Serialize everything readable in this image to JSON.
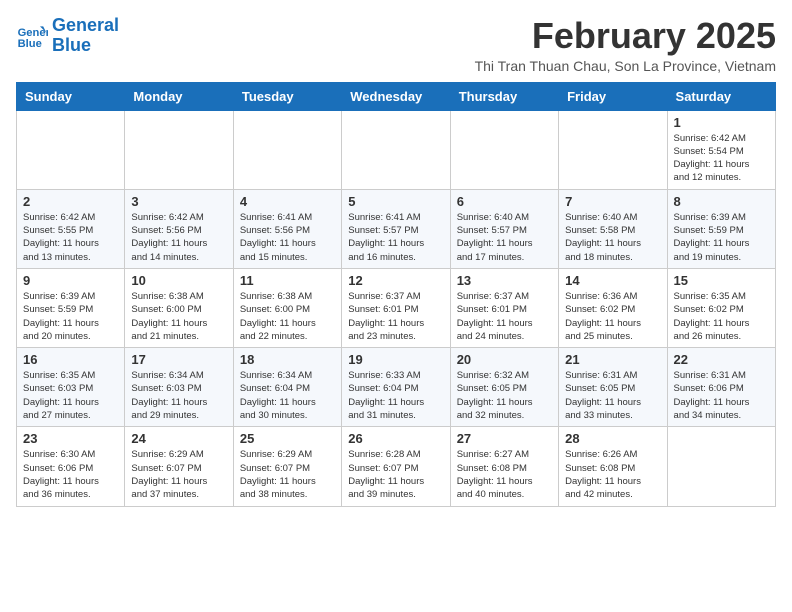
{
  "header": {
    "logo_line1": "General",
    "logo_line2": "Blue",
    "month_title": "February 2025",
    "location": "Thi Tran Thuan Chau, Son La Province, Vietnam"
  },
  "weekdays": [
    "Sunday",
    "Monday",
    "Tuesday",
    "Wednesday",
    "Thursday",
    "Friday",
    "Saturday"
  ],
  "weeks": [
    [
      {
        "day": "",
        "info": ""
      },
      {
        "day": "",
        "info": ""
      },
      {
        "day": "",
        "info": ""
      },
      {
        "day": "",
        "info": ""
      },
      {
        "day": "",
        "info": ""
      },
      {
        "day": "",
        "info": ""
      },
      {
        "day": "1",
        "info": "Sunrise: 6:42 AM\nSunset: 5:54 PM\nDaylight: 11 hours\nand 12 minutes."
      }
    ],
    [
      {
        "day": "2",
        "info": "Sunrise: 6:42 AM\nSunset: 5:55 PM\nDaylight: 11 hours\nand 13 minutes."
      },
      {
        "day": "3",
        "info": "Sunrise: 6:42 AM\nSunset: 5:56 PM\nDaylight: 11 hours\nand 14 minutes."
      },
      {
        "day": "4",
        "info": "Sunrise: 6:41 AM\nSunset: 5:56 PM\nDaylight: 11 hours\nand 15 minutes."
      },
      {
        "day": "5",
        "info": "Sunrise: 6:41 AM\nSunset: 5:57 PM\nDaylight: 11 hours\nand 16 minutes."
      },
      {
        "day": "6",
        "info": "Sunrise: 6:40 AM\nSunset: 5:57 PM\nDaylight: 11 hours\nand 17 minutes."
      },
      {
        "day": "7",
        "info": "Sunrise: 6:40 AM\nSunset: 5:58 PM\nDaylight: 11 hours\nand 18 minutes."
      },
      {
        "day": "8",
        "info": "Sunrise: 6:39 AM\nSunset: 5:59 PM\nDaylight: 11 hours\nand 19 minutes."
      }
    ],
    [
      {
        "day": "9",
        "info": "Sunrise: 6:39 AM\nSunset: 5:59 PM\nDaylight: 11 hours\nand 20 minutes."
      },
      {
        "day": "10",
        "info": "Sunrise: 6:38 AM\nSunset: 6:00 PM\nDaylight: 11 hours\nand 21 minutes."
      },
      {
        "day": "11",
        "info": "Sunrise: 6:38 AM\nSunset: 6:00 PM\nDaylight: 11 hours\nand 22 minutes."
      },
      {
        "day": "12",
        "info": "Sunrise: 6:37 AM\nSunset: 6:01 PM\nDaylight: 11 hours\nand 23 minutes."
      },
      {
        "day": "13",
        "info": "Sunrise: 6:37 AM\nSunset: 6:01 PM\nDaylight: 11 hours\nand 24 minutes."
      },
      {
        "day": "14",
        "info": "Sunrise: 6:36 AM\nSunset: 6:02 PM\nDaylight: 11 hours\nand 25 minutes."
      },
      {
        "day": "15",
        "info": "Sunrise: 6:35 AM\nSunset: 6:02 PM\nDaylight: 11 hours\nand 26 minutes."
      }
    ],
    [
      {
        "day": "16",
        "info": "Sunrise: 6:35 AM\nSunset: 6:03 PM\nDaylight: 11 hours\nand 27 minutes."
      },
      {
        "day": "17",
        "info": "Sunrise: 6:34 AM\nSunset: 6:03 PM\nDaylight: 11 hours\nand 29 minutes."
      },
      {
        "day": "18",
        "info": "Sunrise: 6:34 AM\nSunset: 6:04 PM\nDaylight: 11 hours\nand 30 minutes."
      },
      {
        "day": "19",
        "info": "Sunrise: 6:33 AM\nSunset: 6:04 PM\nDaylight: 11 hours\nand 31 minutes."
      },
      {
        "day": "20",
        "info": "Sunrise: 6:32 AM\nSunset: 6:05 PM\nDaylight: 11 hours\nand 32 minutes."
      },
      {
        "day": "21",
        "info": "Sunrise: 6:31 AM\nSunset: 6:05 PM\nDaylight: 11 hours\nand 33 minutes."
      },
      {
        "day": "22",
        "info": "Sunrise: 6:31 AM\nSunset: 6:06 PM\nDaylight: 11 hours\nand 34 minutes."
      }
    ],
    [
      {
        "day": "23",
        "info": "Sunrise: 6:30 AM\nSunset: 6:06 PM\nDaylight: 11 hours\nand 36 minutes."
      },
      {
        "day": "24",
        "info": "Sunrise: 6:29 AM\nSunset: 6:07 PM\nDaylight: 11 hours\nand 37 minutes."
      },
      {
        "day": "25",
        "info": "Sunrise: 6:29 AM\nSunset: 6:07 PM\nDaylight: 11 hours\nand 38 minutes."
      },
      {
        "day": "26",
        "info": "Sunrise: 6:28 AM\nSunset: 6:07 PM\nDaylight: 11 hours\nand 39 minutes."
      },
      {
        "day": "27",
        "info": "Sunrise: 6:27 AM\nSunset: 6:08 PM\nDaylight: 11 hours\nand 40 minutes."
      },
      {
        "day": "28",
        "info": "Sunrise: 6:26 AM\nSunset: 6:08 PM\nDaylight: 11 hours\nand 42 minutes."
      },
      {
        "day": "",
        "info": ""
      }
    ]
  ]
}
